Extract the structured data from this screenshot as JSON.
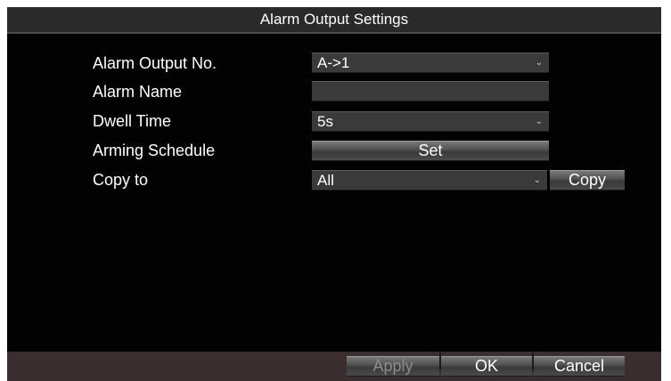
{
  "window": {
    "title": "Alarm Output Settings"
  },
  "form": {
    "alarm_output_no": {
      "label": "Alarm Output No.",
      "value": "A->1",
      "icon": "chevron-down-icon"
    },
    "alarm_name": {
      "label": "Alarm Name",
      "value": ""
    },
    "dwell_time": {
      "label": "Dwell Time",
      "value": "5s",
      "icon": "chevron-down-icon"
    },
    "arming_schedule": {
      "label": "Arming Schedule",
      "button_label": "Set"
    },
    "copy_to": {
      "label": "Copy to",
      "value": "All",
      "icon": "chevron-down-icon",
      "button_label": "Copy"
    }
  },
  "footer": {
    "apply_label": "Apply",
    "apply_enabled": false,
    "ok_label": "OK",
    "cancel_label": "Cancel"
  },
  "colors": {
    "panel_bg": "#020202",
    "title_bg": "#2a2a2a",
    "field_bg": "#3a3a3a",
    "footer_bg": "#3a2e2e",
    "text": "#ffffff",
    "disabled_text": "#8c8c8c"
  }
}
